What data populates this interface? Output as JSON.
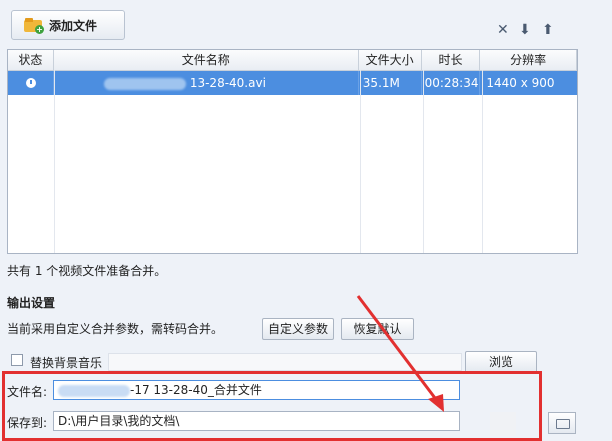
{
  "toolbar": {
    "add_file_label": "添加文件",
    "icons": [
      "close-icon",
      "arrow-down-icon",
      "arrow-up-icon"
    ],
    "icon_glyphs": [
      "✕",
      "⬇",
      "⬆"
    ]
  },
  "file_table": {
    "columns": [
      "状态",
      "文件名称",
      "文件大小",
      "时长",
      "分辨率"
    ],
    "rows": [
      {
        "status_icon": "clock-icon",
        "name_visible_part": "13-28-40.avi",
        "size": "35.1M",
        "duration": "00:28:34",
        "resolution": "1440 x 900"
      }
    ]
  },
  "summary_text": "共有 1 个视频文件准备合并。",
  "output": {
    "title": "输出设置",
    "note": "当前采用自定义合并参数，需转码合并。",
    "custom_params_label": "自定义参数",
    "restore_default_label": "恢复默认",
    "replace_music_label": "替换背景音乐",
    "browse_label": "浏览",
    "filename_label": "文件名:",
    "filename_value_visible": "-17 13-28-40_合并文件",
    "save_to_label": "保存到:",
    "save_to_value": "D:\\用户目录\\我的文档\\"
  },
  "colors": {
    "selection": "#4c8ee0",
    "annotation": "#e23030"
  }
}
